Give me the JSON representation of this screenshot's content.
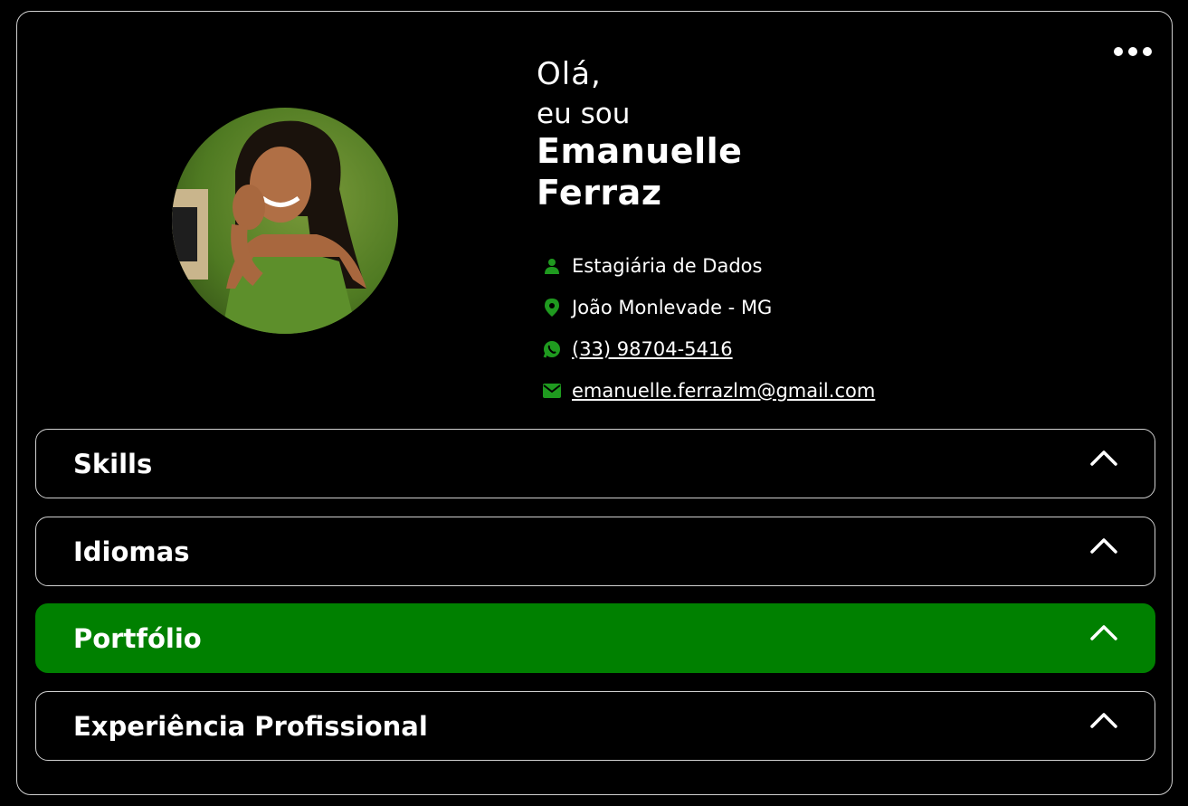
{
  "header": {
    "greeting": "Olá,",
    "intro": "eu sou",
    "first_name": "Emanuelle",
    "last_name": "Ferraz",
    "menu_icon": "more-horizontal-icon"
  },
  "profile": {
    "avatar_alt": "avatar-photo",
    "accent_color": "#008000"
  },
  "contact": {
    "role": "Estagiária de Dados",
    "role_icon": "user-icon",
    "location": "João Monlevade - MG",
    "location_icon": "map-pin-icon",
    "phone": "(33) 98704-5416",
    "phone_icon": "whatsapp-icon",
    "email": "emanuelle.ferrazlm@gmail.com",
    "email_icon": "envelope-icon"
  },
  "sections": [
    {
      "label": "Skills",
      "icon": "chevron-up-icon",
      "active": false
    },
    {
      "label": "Idiomas",
      "icon": "chevron-up-icon",
      "active": false
    },
    {
      "label": "Portfólio",
      "icon": "chevron-up-icon",
      "active": true
    },
    {
      "label": "Experiência Profissional",
      "icon": "chevron-up-icon",
      "active": false
    }
  ]
}
